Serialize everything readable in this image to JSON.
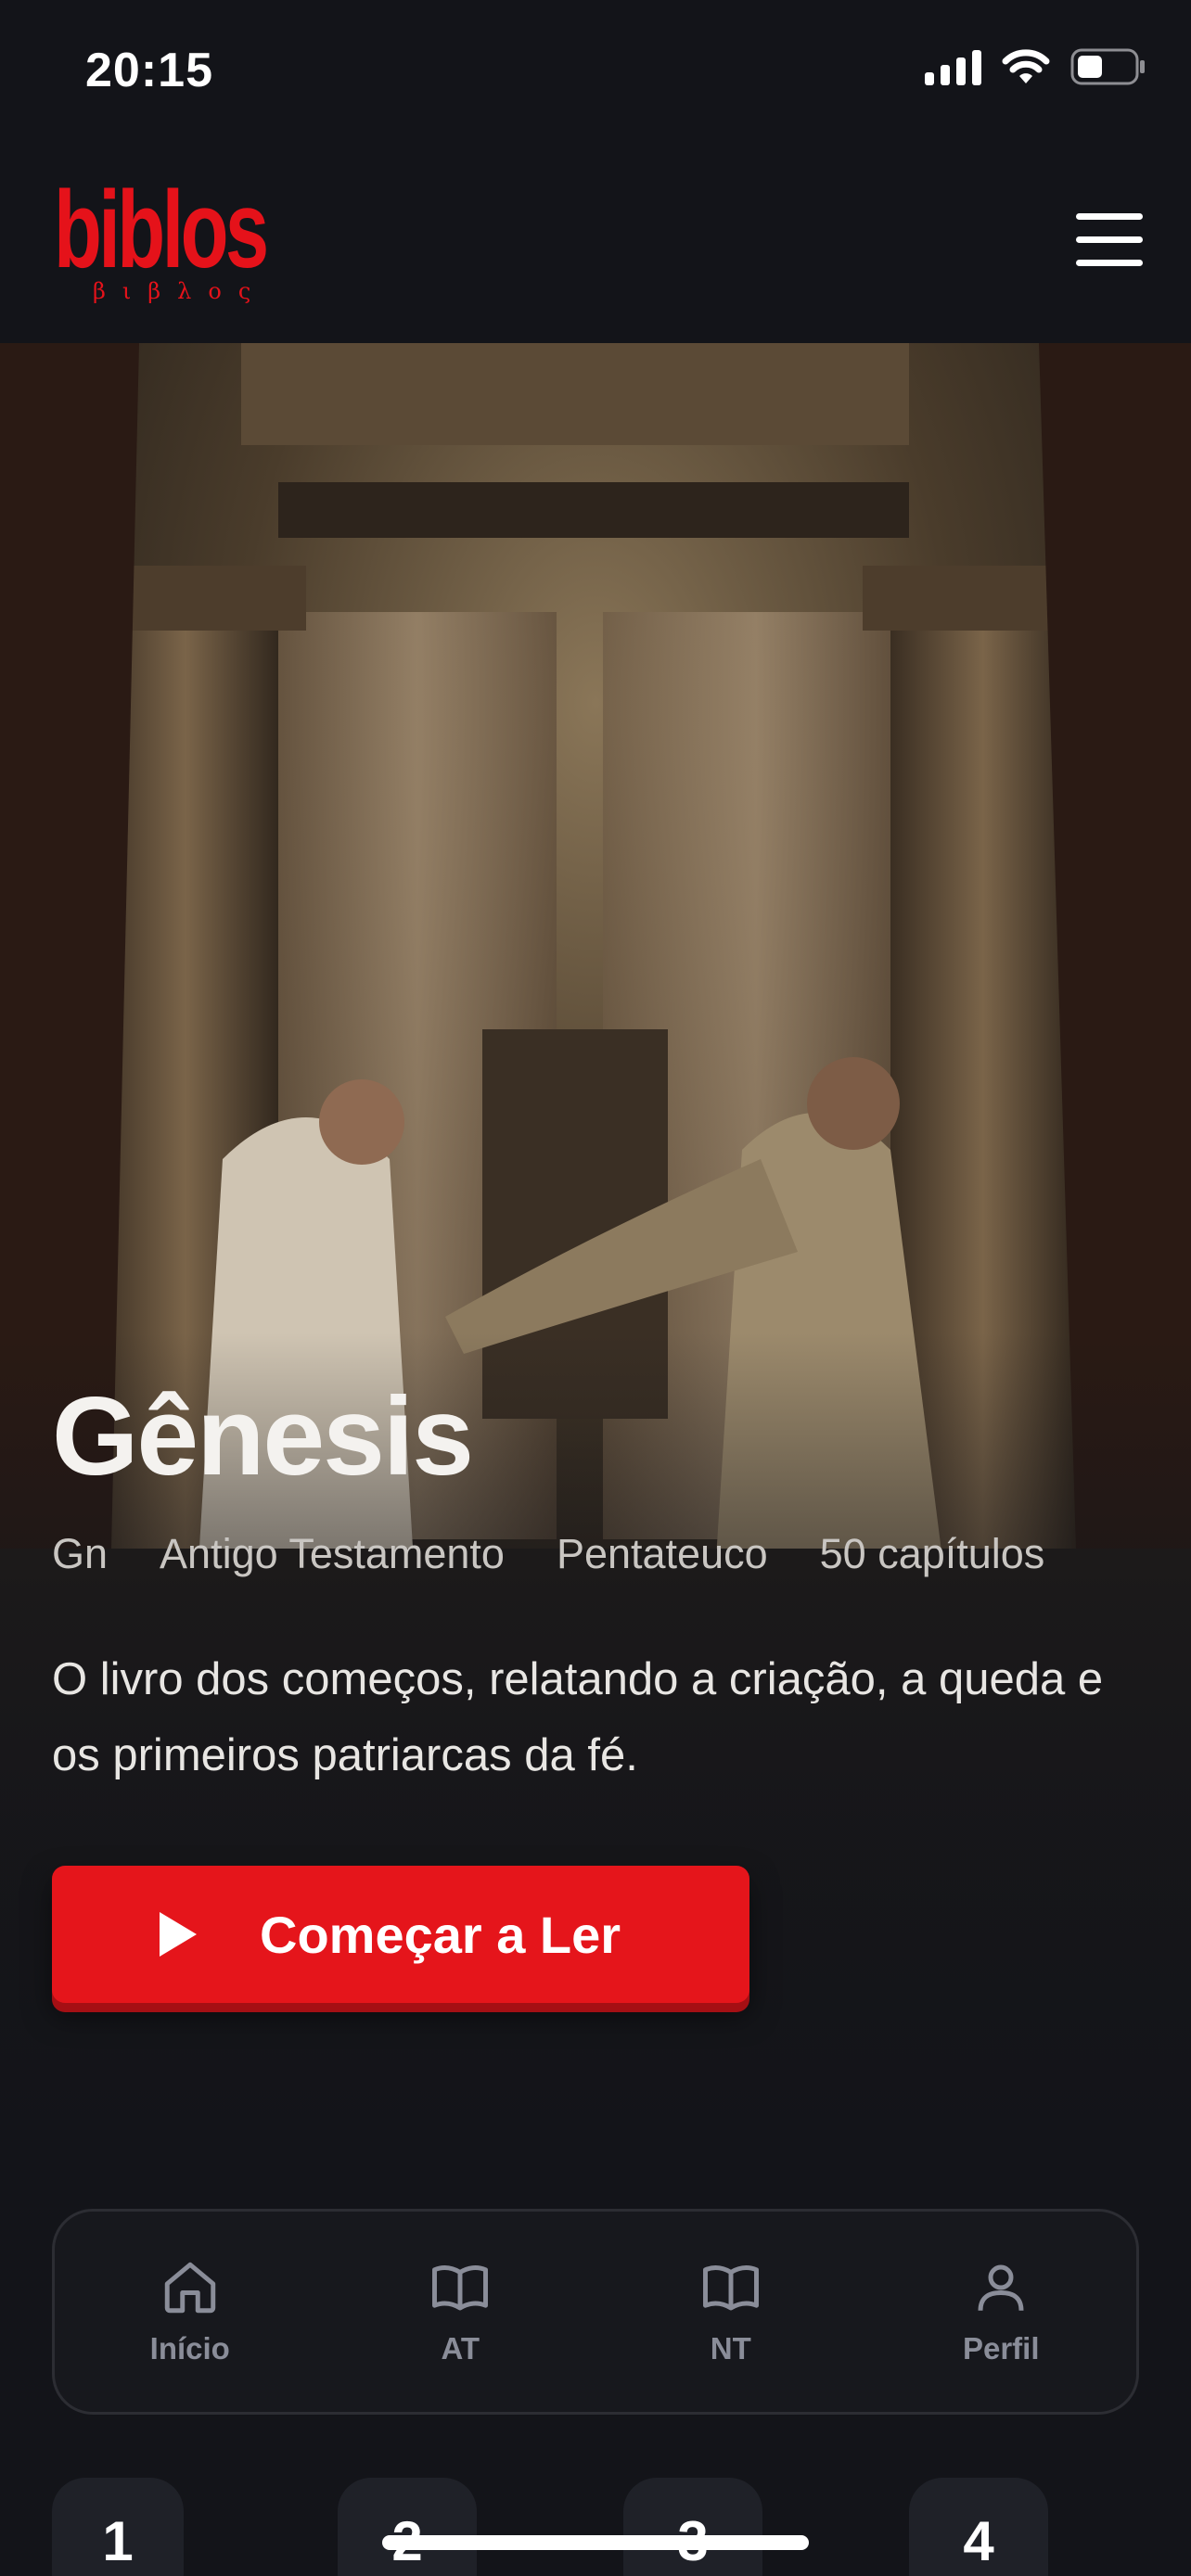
{
  "status_bar": {
    "time": "20:15",
    "signal_icon": "signal-icon",
    "wifi_icon": "wifi-icon",
    "battery_icon": "battery-icon"
  },
  "header": {
    "logo_text": "biblos",
    "logo_greek": "βιβλος",
    "menu_icon": "hamburger-menu-icon"
  },
  "hero": {
    "title": "Gênesis",
    "meta": [
      "Gn",
      "Antigo Testamento",
      "Pentateuco",
      "50 capítulos"
    ],
    "description": "O livro dos começos, relatando a criação, a queda e os primeiros patriarcas da fé.",
    "cta_label": "Começar a Ler",
    "cta_icon": "play-icon"
  },
  "bottom_nav": [
    {
      "label": "Início",
      "icon": "home-icon"
    },
    {
      "label": "AT",
      "icon": "book-open-icon"
    },
    {
      "label": "NT",
      "icon": "book-open-icon"
    },
    {
      "label": "Perfil",
      "icon": "user-icon"
    }
  ],
  "chapters": [
    "1",
    "2",
    "3",
    "4"
  ],
  "colors": {
    "accent": "#e5151b",
    "background": "#131419",
    "nav_text": "#8a8d99"
  }
}
